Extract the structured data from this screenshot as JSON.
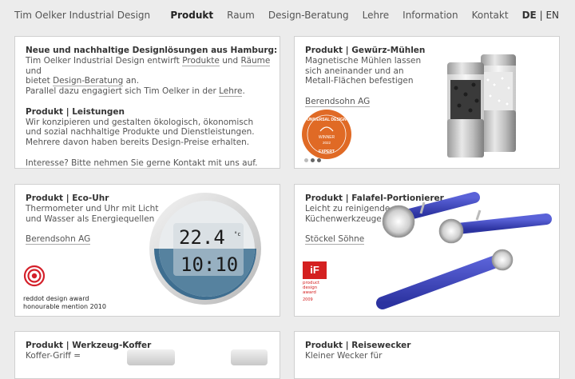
{
  "header": {
    "brand": "Tim Oelker Industrial Design",
    "nav": [
      "Produkt",
      "Raum",
      "Design-Beratung",
      "Lehre",
      "Information",
      "Kontakt"
    ],
    "lang": {
      "de": "DE",
      "sep": "|",
      "en": "EN"
    }
  },
  "intro": {
    "title": "Neue und nachhaltige Designlösungen aus Hamburg:",
    "l1a": "Tim Oelker Industrial Design entwirft ",
    "l1link1": "Produkte",
    "l1b": " und ",
    "l1link2": "Räume",
    "l1c": " und",
    "l2a": "bietet ",
    "l2link": "Design-Beratung",
    "l2b": " an.",
    "l3a": "Parallel dazu engagiert sich Tim Oelker in der ",
    "l3link": "Lehre",
    "l3b": ".",
    "heading2": "Produkt | Leistungen",
    "p2": [
      "Wir konzipieren und gestalten ökologisch, ökonomisch",
      "und sozial nachhaltige Produkte und Dienstleistungen.",
      "Mehrere davon haben bereits Design-Preise erhalten."
    ],
    "p3a": "Interesse? Bitte nehmen Sie gerne ",
    "p3link": "Kontakt",
    "p3b": " mit uns auf."
  },
  "cards": {
    "mills": {
      "title": "Produkt | Gewürz-Mühlen",
      "lines": [
        "Magnetische Mühlen lassen",
        "sich aneinander und an",
        "Metall-Flächen befestigen"
      ],
      "link": "Berendsohn AG",
      "badge_top": "UNIVERSAL DESIGN",
      "badge_mid": "WINNER",
      "badge_year": "2022",
      "badge_bottom": "EXPERT"
    },
    "clock": {
      "title": "Produkt | Eco-Uhr",
      "lines": [
        "Thermometer und Uhr mit Licht",
        "und Wasser als Energiequellen"
      ],
      "link": "Berendsohn AG",
      "award1": "reddot design award",
      "award2": "honourable mention 2010",
      "temp": "22.4",
      "tempunit": "°c",
      "time": "10:10"
    },
    "falafel": {
      "title": "Produkt | Falafel-Portionierer",
      "lines": [
        "Leicht zu reinigende",
        "Küchenwerkzeuge"
      ],
      "link": "Stöckel Söhne",
      "if_logo": "iF",
      "if_lines": [
        "product",
        "design",
        "award"
      ],
      "if_year": "2009"
    },
    "toolbox": {
      "title": "Produkt | Werkzeug-Koffer",
      "lines": [
        "Koffer-Griff ="
      ]
    },
    "alarm": {
      "title": "Produkt | Reisewecker",
      "lines": [
        "Kleiner Wecker für"
      ]
    }
  },
  "colors": {
    "accent_blue": "#3d44b8",
    "badge_orange": "#e06a25",
    "reddot": "#d4202a",
    "if_red": "#d42020"
  }
}
